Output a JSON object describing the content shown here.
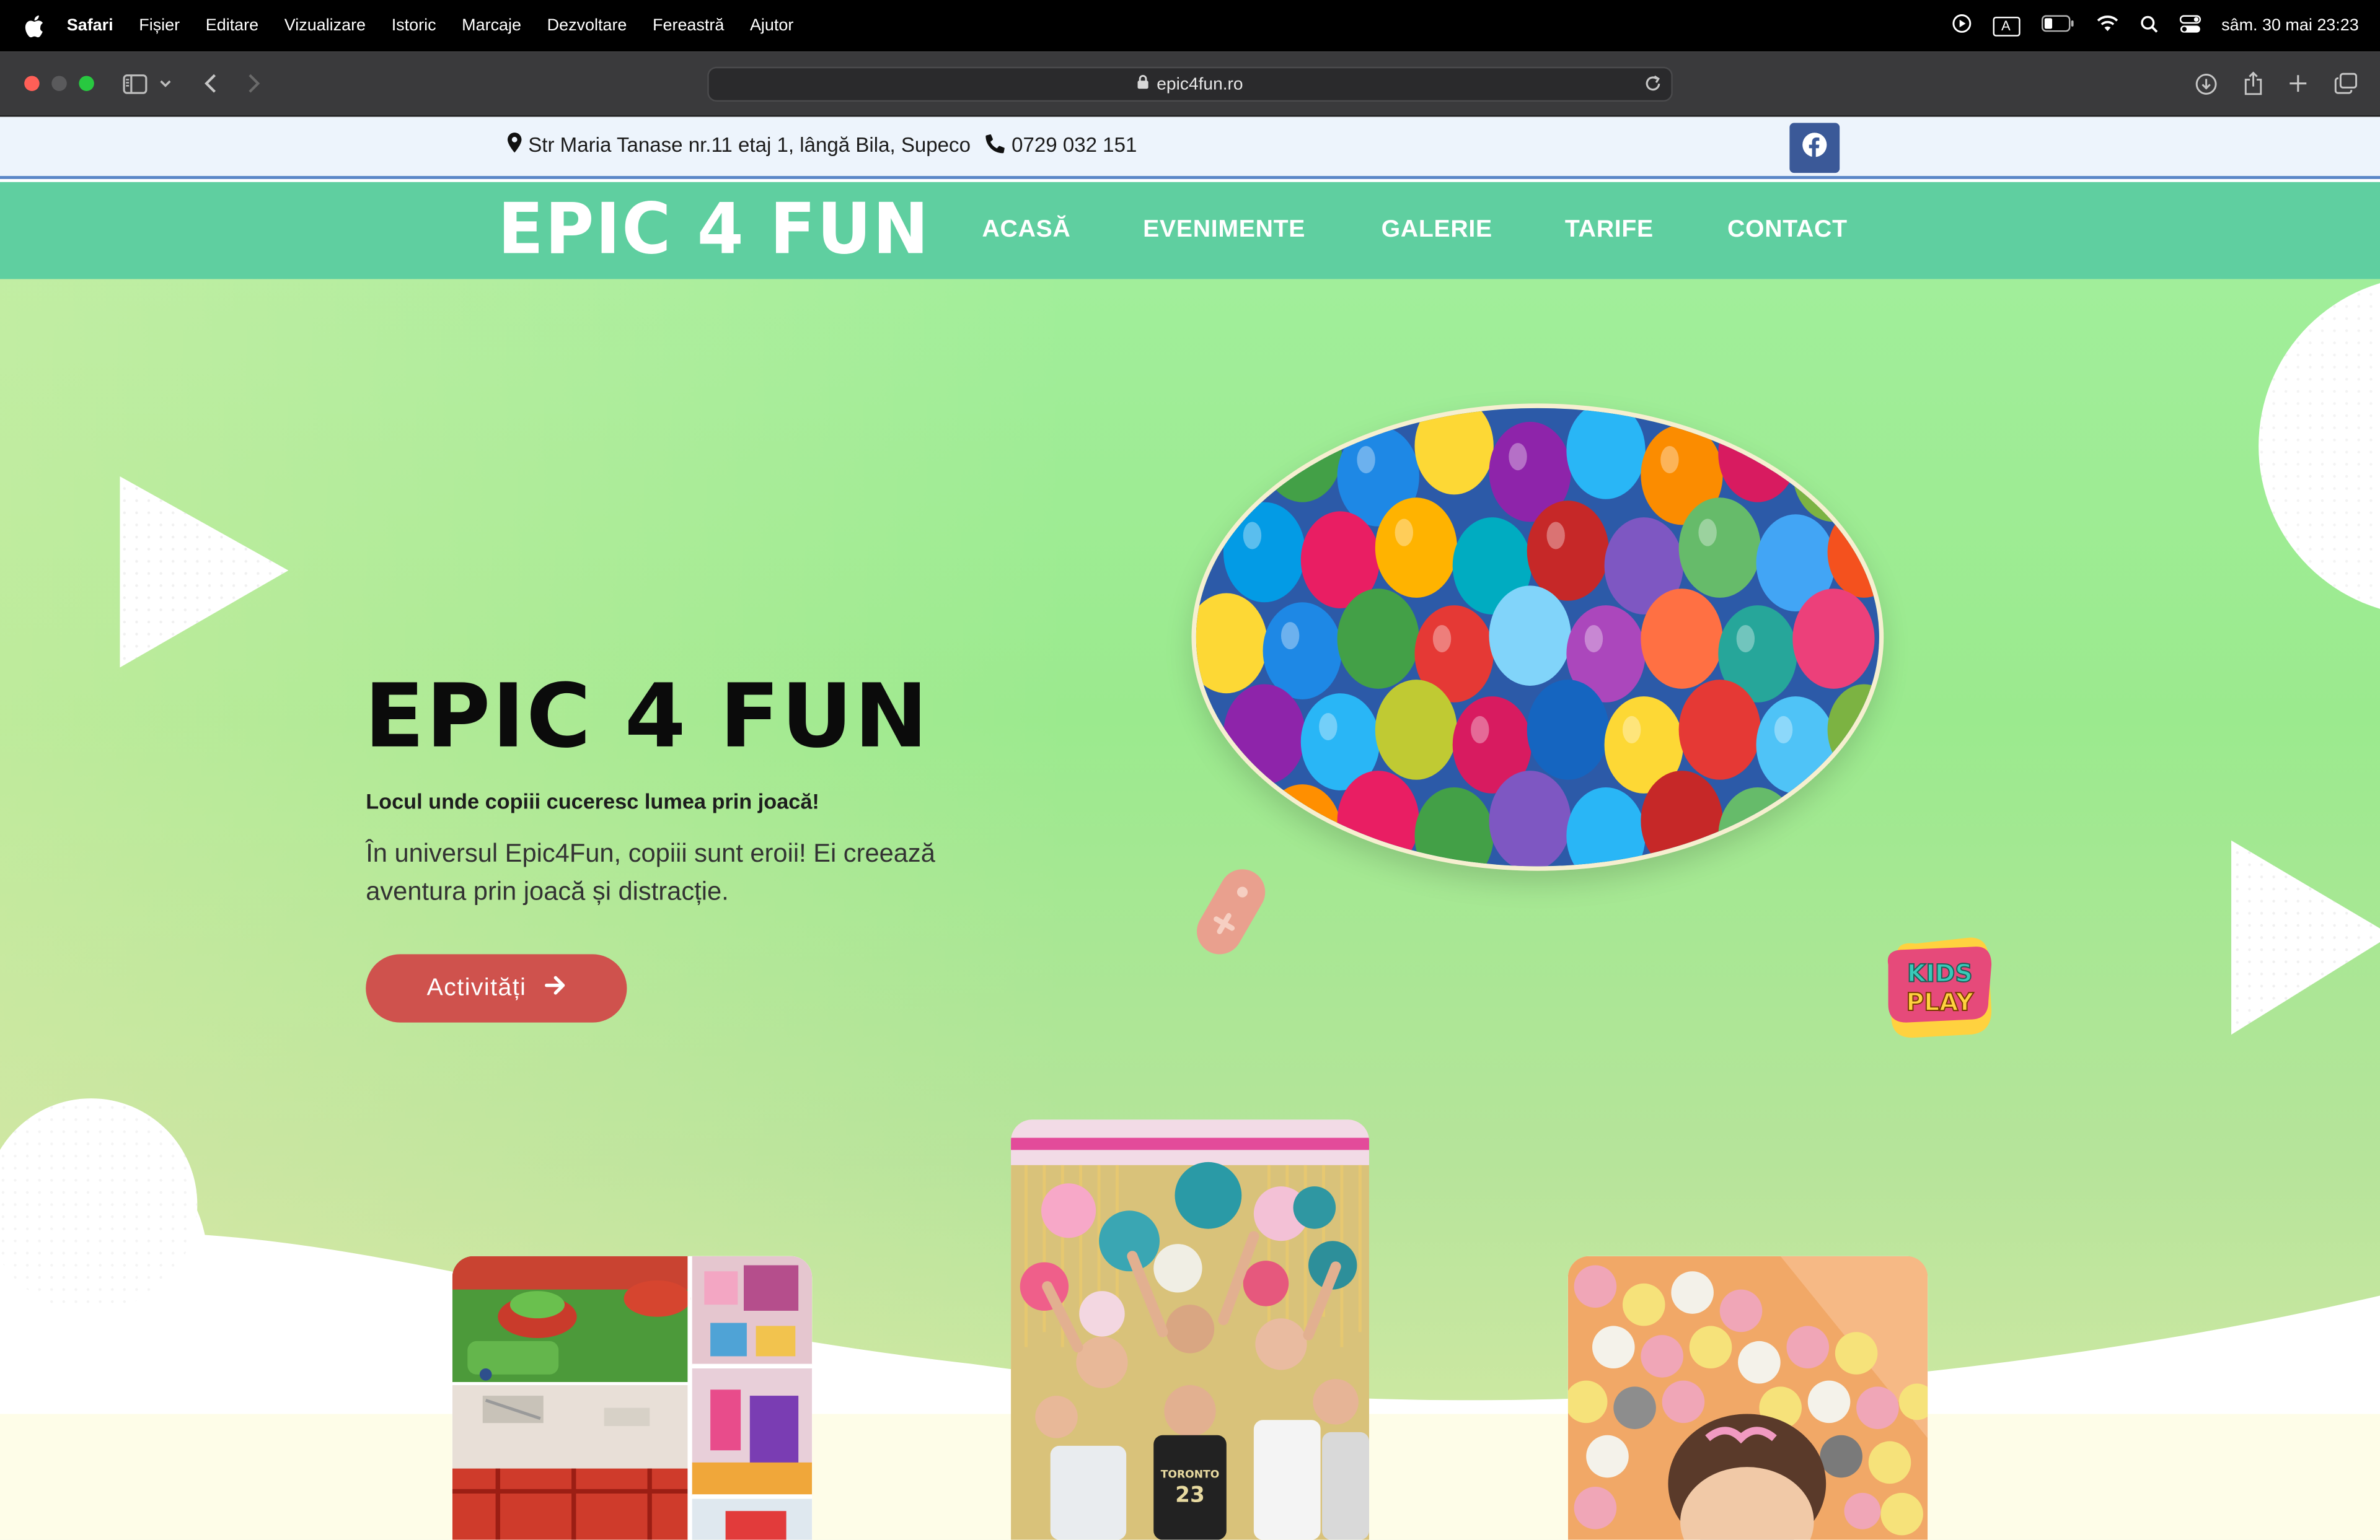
{
  "menubar": {
    "app": "Safari",
    "items": [
      "Fișier",
      "Editare",
      "Vizualizare",
      "Istoric",
      "Marcaje",
      "Dezvoltare",
      "Fereastră",
      "Ajutor"
    ],
    "clock": "sâm. 30 mai  23:23",
    "keyboard_indicator": "A"
  },
  "browser": {
    "url": "epic4fun.ro"
  },
  "topbar": {
    "address": "Str Maria Tanase nr.11 etaj 1, lângă Bila, Supeco",
    "phone": "0729 032 151"
  },
  "nav": {
    "logo": "EPIC 4 FUN",
    "links": [
      "ACASĂ",
      "EVENIMENTE",
      "GALERIE",
      "TARIFE",
      "CONTACT"
    ]
  },
  "hero": {
    "title": "EPIC 4 FUN",
    "subtitle": "Locul unde copiii cuceresc lumea prin joacă!",
    "description": "În universul Epic4Fun, copiii sunt eroii! Ei creează aventura prin joacă și distracție.",
    "cta_label": "Activități",
    "sticker_text_line1": "KIDS",
    "sticker_text_line2": "PLAY",
    "jersey_text": "TORONTO",
    "jersey_number": "23"
  },
  "colors": {
    "nav_bg": "#5fcfa0",
    "topbar_bg": "#edf4fc",
    "cta_bg": "#cf524d",
    "facebook": "#3b5998",
    "hero_green": "#a1ee9a"
  },
  "icons": {
    "pin": "map-pin-icon",
    "phone": "phone-icon",
    "facebook": "facebook-icon",
    "arrow": "arrow-right-icon"
  }
}
